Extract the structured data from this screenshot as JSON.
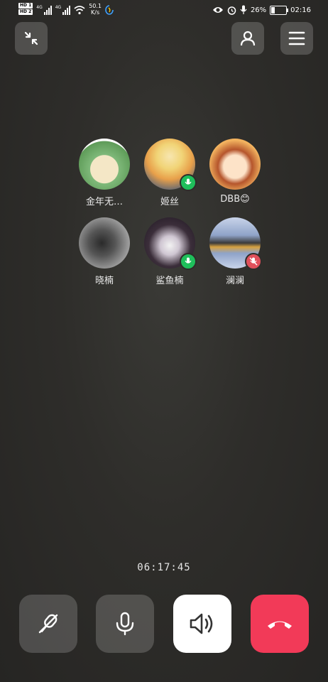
{
  "status_bar": {
    "sim1": "HD 1",
    "sim2": "HD 2",
    "net1": "4G",
    "net2": "4G",
    "speed_value": "50.1",
    "speed_unit": "K/s",
    "battery": "26%",
    "time": "02:16"
  },
  "top_bar": {
    "minimize_icon": "minimize-arrows-icon",
    "profile_icon": "person-icon",
    "menu_icon": "hamburger-menu-icon"
  },
  "participants": [
    {
      "name": "金年无…",
      "mic": "none",
      "avatar_color": "#7fb97a"
    },
    {
      "name": "姬丝",
      "mic": "on",
      "avatar_color": "#e8a04a"
    },
    {
      "name": "DBB😊",
      "mic": "none",
      "avatar_color": "#f3b460"
    },
    {
      "name": "晓楠",
      "mic": "none",
      "avatar_color": "#8a8a8a"
    },
    {
      "name": "鲨鱼楠",
      "mic": "on",
      "avatar_color": "#3b2e3a"
    },
    {
      "name": "澜澜",
      "mic": "off",
      "avatar_color": "#8fa3c8"
    }
  ],
  "call": {
    "duration": "06:17:45"
  },
  "controls": [
    {
      "icon": "microphone-crossed-icon",
      "state": "inactive"
    },
    {
      "icon": "microphone-icon",
      "state": "inactive"
    },
    {
      "icon": "speaker-icon",
      "state": "active"
    },
    {
      "icon": "hang-up-icon",
      "state": "danger"
    }
  ],
  "colors": {
    "background": "#2e2d2a",
    "mic_on": "#1fbf5b",
    "mic_off": "#e0505b",
    "hang_up": "#f23a58"
  }
}
